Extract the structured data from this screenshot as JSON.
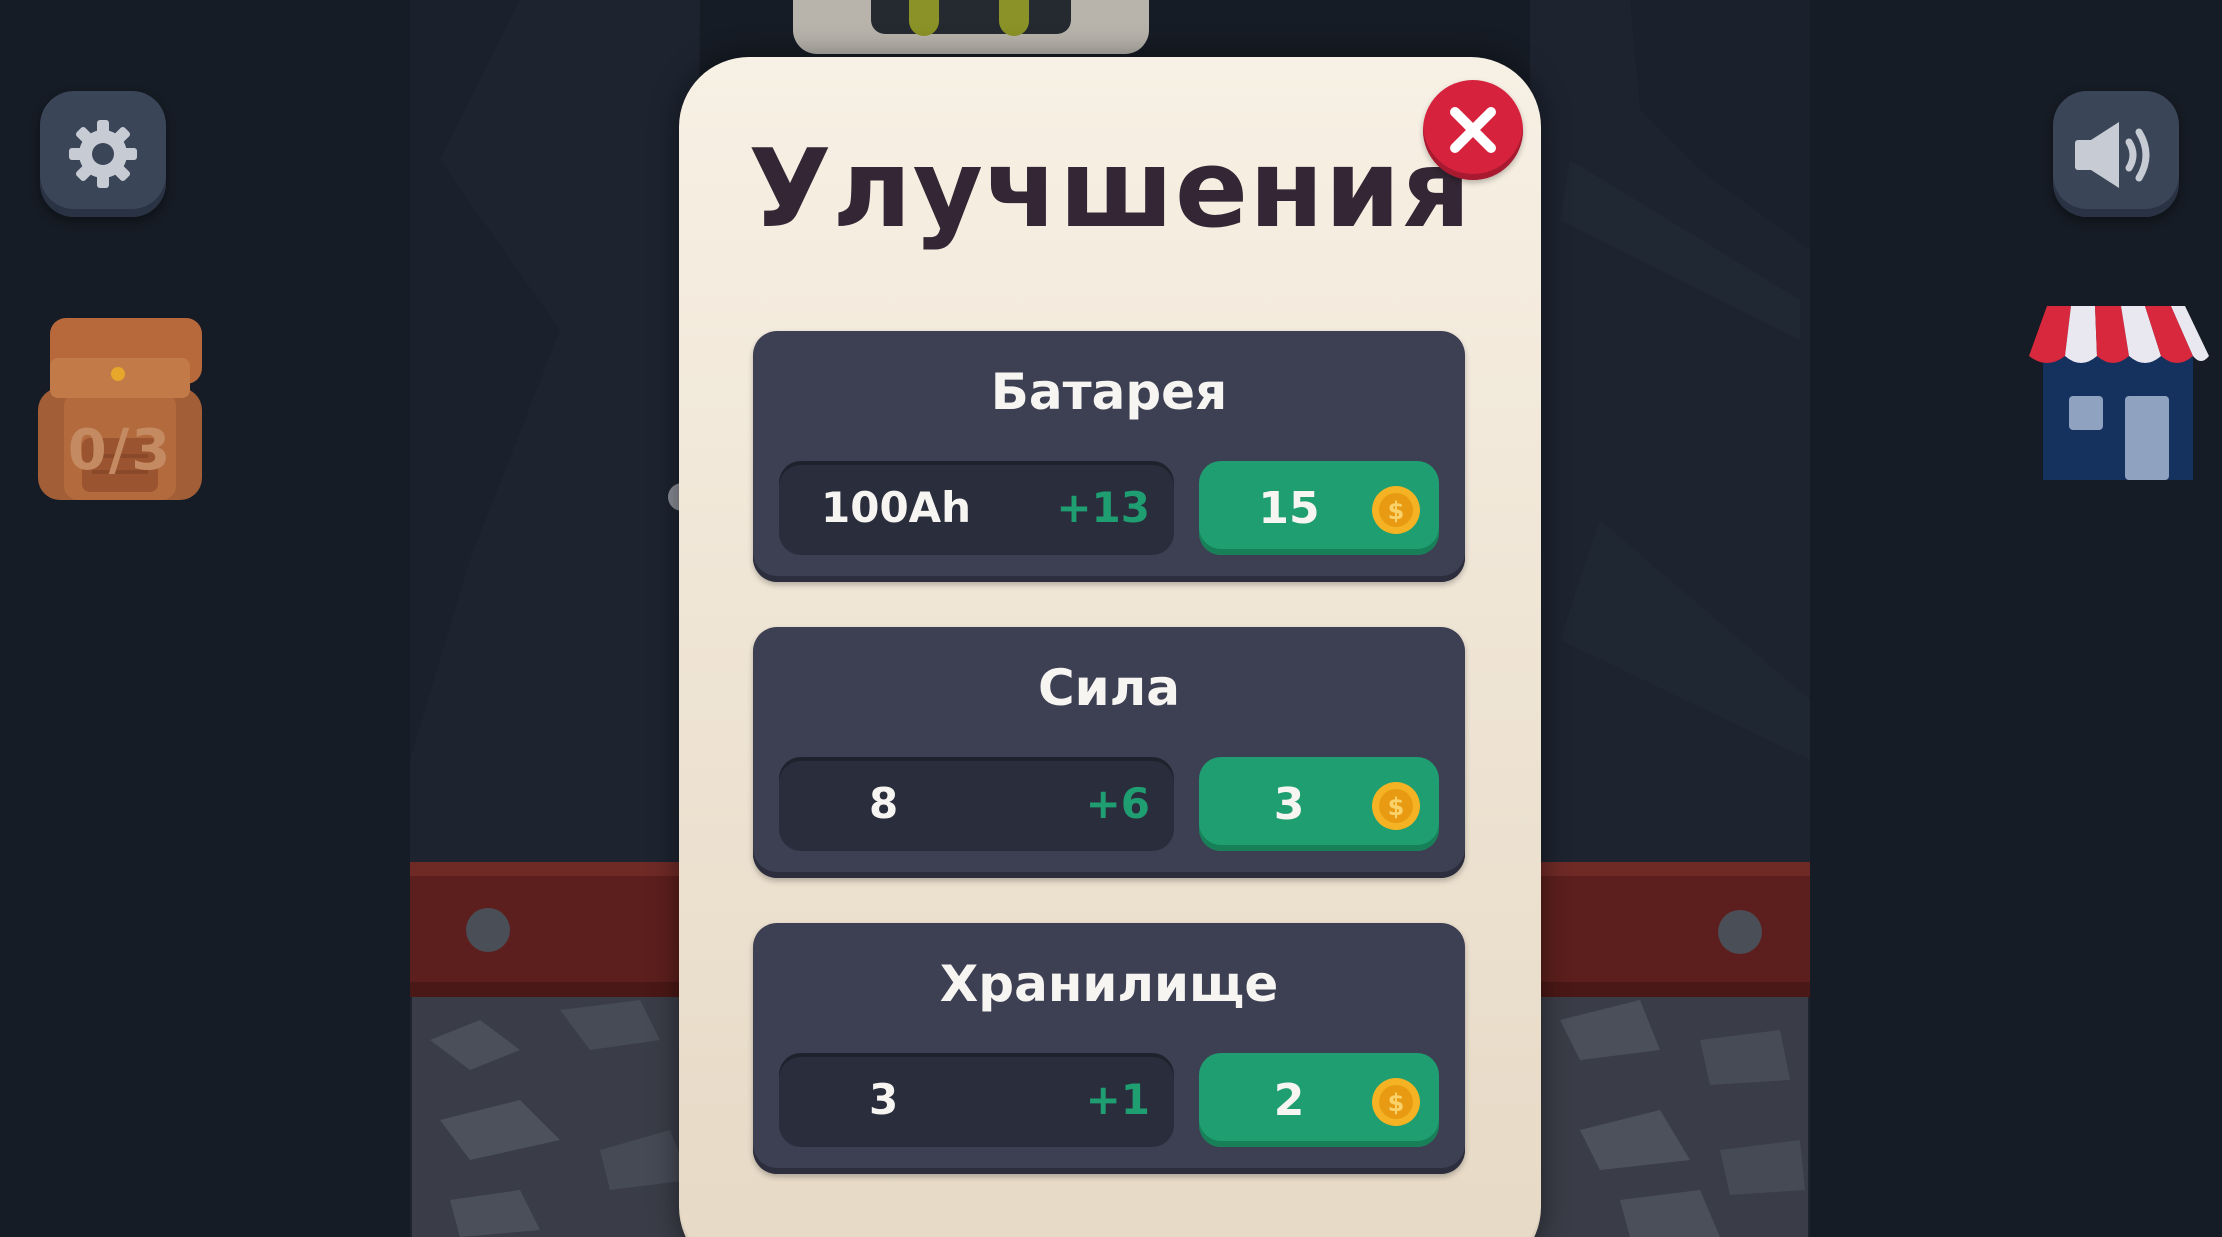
{
  "modal": {
    "title": "Улучшения",
    "close_icon": "close-icon"
  },
  "hud": {
    "settings_icon": "gear-icon",
    "sound_icon": "speaker-icon",
    "backpack_icon": "backpack-icon",
    "backpack_count": "0/3",
    "shop_icon": "shop-icon"
  },
  "upgrades": [
    {
      "name": "Батарея",
      "value": "100Ah",
      "bonus": "+13",
      "price": "15",
      "currency_icon": "coin-icon"
    },
    {
      "name": "Сила",
      "value": "8",
      "bonus": "+6",
      "price": "3",
      "currency_icon": "coin-icon"
    },
    {
      "name": "Хранилище",
      "value": "3",
      "bonus": "+1",
      "price": "2",
      "currency_icon": "coin-icon"
    }
  ],
  "colors": {
    "modal_bg": "#f2e9dc",
    "card_bg": "#3d3f52",
    "buy_button": "#1f9e72",
    "close_button": "#d6223d",
    "title_text": "#342634",
    "bonus_text": "#1f9e72"
  }
}
